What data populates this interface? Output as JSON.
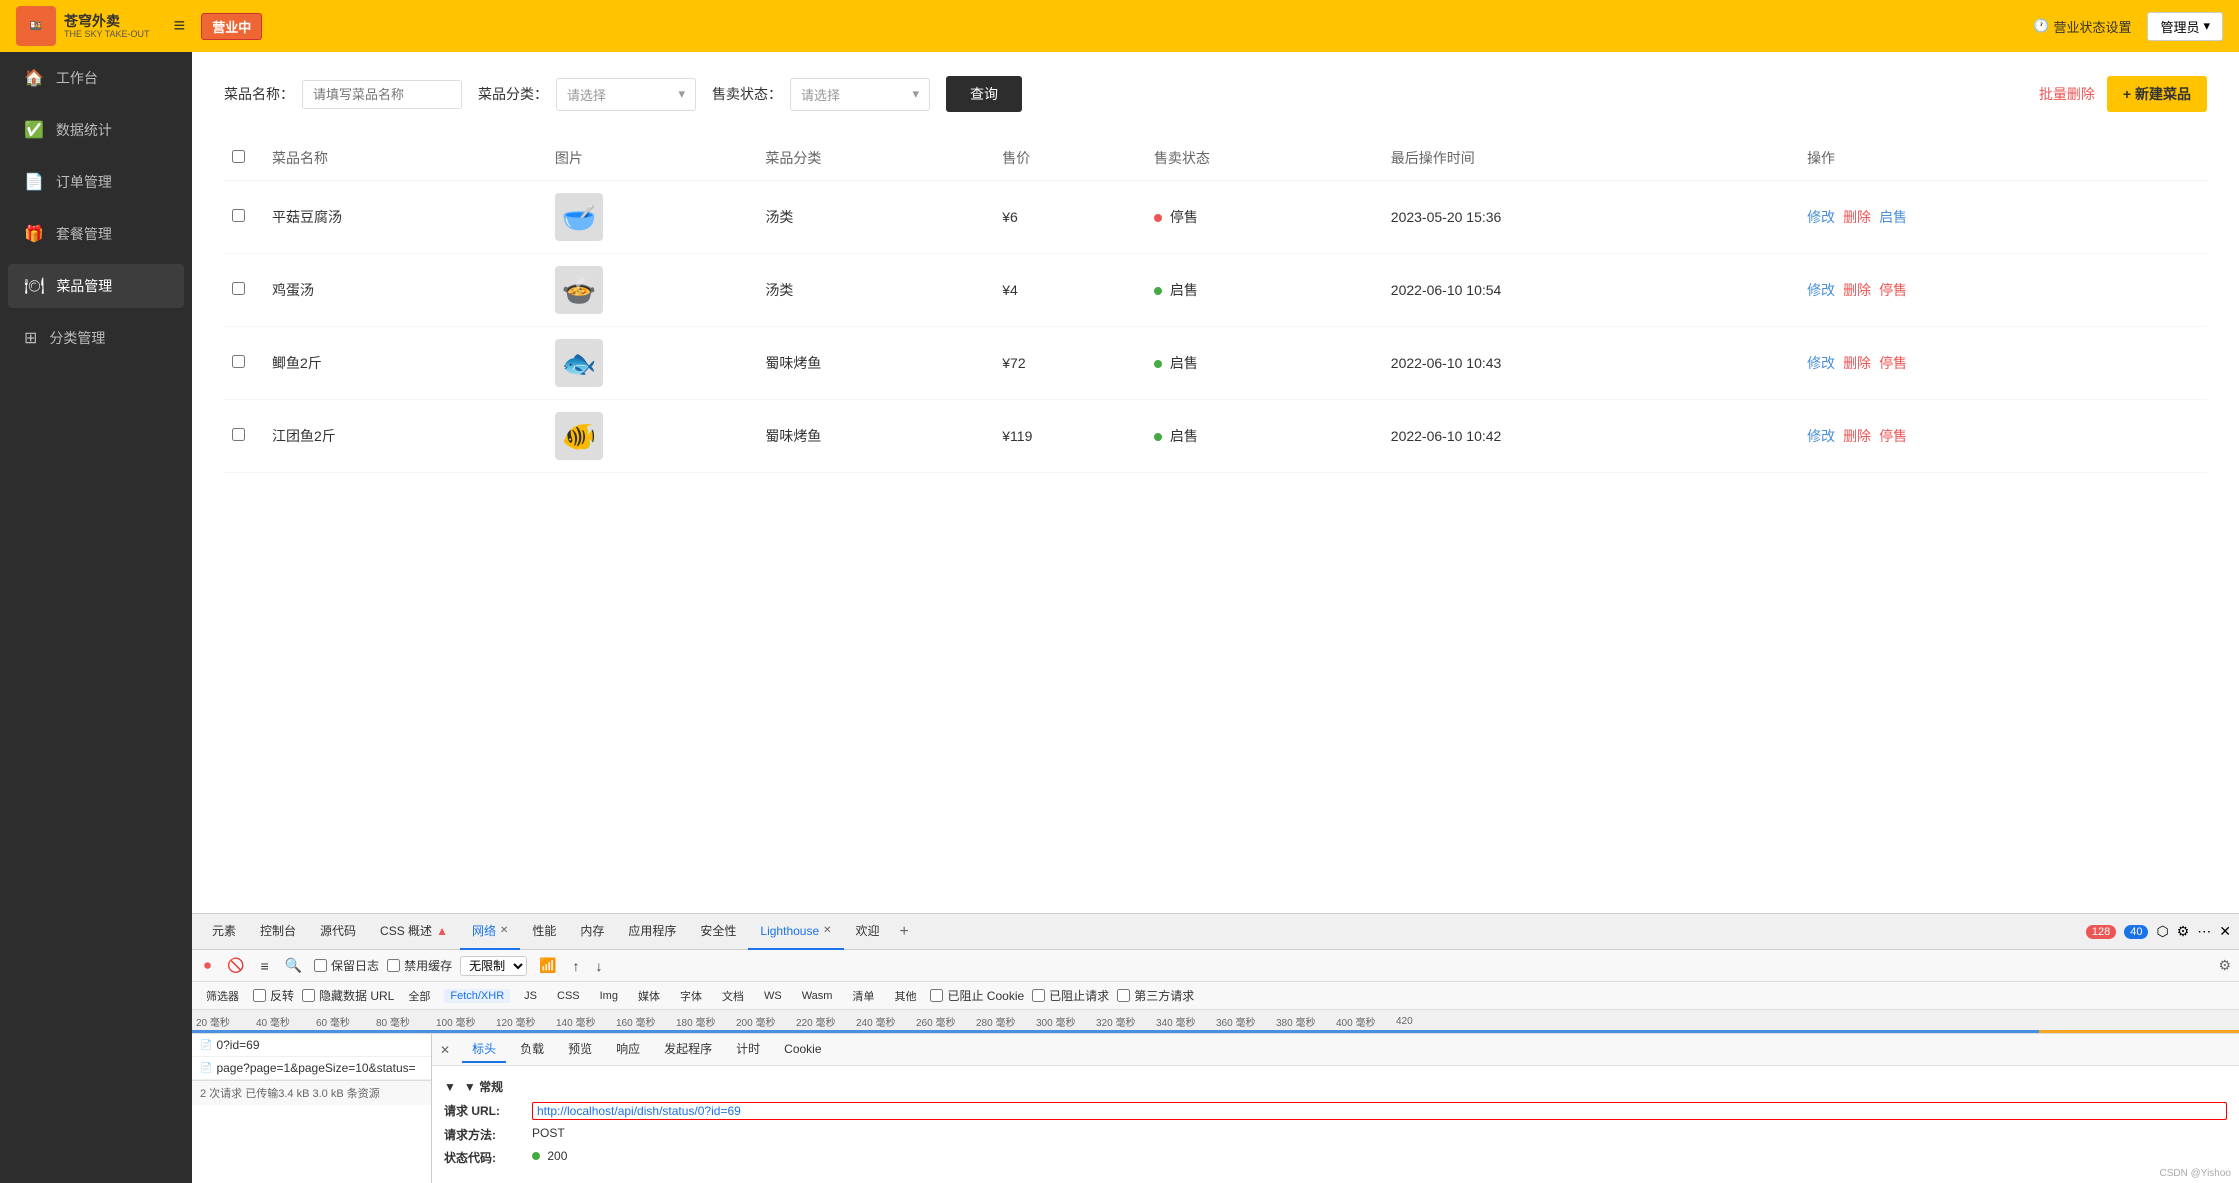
{
  "header": {
    "logo_text": "苍穹外卖",
    "logo_subtext": "THE SKY TAKE-OUT",
    "menu_icon": "≡",
    "status_badge": "营业中",
    "biz_status_label": "营业状态设置",
    "admin_label": "管理员",
    "clock_icon": "🕐"
  },
  "sidebar": {
    "items": [
      {
        "id": "workbench",
        "icon": "🏠",
        "label": "工作台"
      },
      {
        "id": "data-stats",
        "icon": "✅",
        "label": "数据统计"
      },
      {
        "id": "order-mgmt",
        "icon": "📄",
        "label": "订单管理"
      },
      {
        "id": "package-mgmt",
        "icon": "🎁",
        "label": "套餐管理"
      },
      {
        "id": "dish-mgmt",
        "icon": "🍽",
        "label": "菜品管理",
        "active": true
      },
      {
        "id": "category-mgmt",
        "icon": "⊞",
        "label": "分类管理"
      }
    ]
  },
  "filter": {
    "dish_name_label": "菜品名称：",
    "dish_name_placeholder": "请填写菜品名称",
    "category_label": "菜品分类：",
    "category_placeholder": "请选择",
    "status_label": "售卖状态：",
    "status_placeholder": "请选择",
    "query_btn": "查询",
    "batch_delete_btn": "批量删除",
    "new_dish_btn": "+ 新建菜品"
  },
  "table": {
    "headers": [
      "",
      "菜品名称",
      "图片",
      "菜品分类",
      "售价",
      "售卖状态",
      "最后操作时间",
      "操作"
    ],
    "rows": [
      {
        "name": "平菇豆腐汤",
        "img_emoji": "🥣",
        "category": "汤类",
        "price": "¥6",
        "status": "停售",
        "status_type": "red",
        "time": "2023-05-20 15:36",
        "actions": [
          "修改",
          "删除",
          "启售"
        ]
      },
      {
        "name": "鸡蛋汤",
        "img_emoji": "🍲",
        "category": "汤类",
        "price": "¥4",
        "status": "启售",
        "status_type": "green",
        "time": "2022-06-10 10:54",
        "actions": [
          "修改",
          "删除",
          "停售"
        ]
      },
      {
        "name": "鲫鱼2斤",
        "img_emoji": "🐟",
        "category": "蜀味烤鱼",
        "price": "¥72",
        "status": "启售",
        "status_type": "green",
        "time": "2022-06-10 10:43",
        "actions": [
          "修改",
          "删除",
          "停售"
        ]
      },
      {
        "name": "江团鱼2斤",
        "img_emoji": "🐠",
        "category": "蜀味烤鱼",
        "price": "¥119",
        "status": "启售",
        "status_type": "green",
        "time": "2022-06-10 10:42",
        "actions": [
          "修改",
          "删除",
          "停售"
        ]
      }
    ]
  },
  "devtools": {
    "tabs": [
      {
        "label": "元素",
        "active": false
      },
      {
        "label": "控制台",
        "active": false
      },
      {
        "label": "源代码",
        "active": false
      },
      {
        "label": "CSS 概述",
        "active": false,
        "has_dot": true
      },
      {
        "label": "网络",
        "active": true,
        "closable": true
      },
      {
        "label": "性能",
        "active": false
      },
      {
        "label": "内存",
        "active": false
      },
      {
        "label": "应用程序",
        "active": false
      },
      {
        "label": "安全性",
        "active": false
      },
      {
        "label": "Lighthouse",
        "active": true,
        "closable": true
      },
      {
        "label": "欢迎",
        "active": false
      }
    ],
    "badge_red": "128",
    "badge_blue": "40",
    "toolbar": {
      "record_icon": "⏺",
      "stop_icon": "🚫",
      "clear_icon": "≡",
      "search_icon": "🔍",
      "preserve_log": "保留日志",
      "disable_cache": "禁用缓存",
      "throttle": "无限制",
      "wifi_icon": "📶",
      "up_icon": "↑",
      "down_icon": "↓"
    },
    "filter_bar": {
      "selector_label": "筛选器",
      "invert": "反转",
      "hide_data_urls": "隐藏数据 URL",
      "all": "全部",
      "types": [
        "Fetch/XHR",
        "JS",
        "CSS",
        "Img",
        "媒体",
        "字体",
        "文档",
        "WS",
        "Wasm",
        "清单",
        "其他"
      ],
      "blocked_cookie": "已阻止 Cookie",
      "blocked_request": "已阻止请求",
      "third_party": "第三方请求"
    },
    "timeline_labels": [
      "20 毫秒",
      "40 毫秒",
      "60 毫秒",
      "80 毫秒",
      "100 毫秒",
      "120 毫秒",
      "140 毫秒",
      "160 毫秒",
      "180 毫秒",
      "200 毫秒",
      "220 毫秒",
      "240 毫秒",
      "260 毫秒",
      "280 毫秒",
      "300 毫秒",
      "320 毫秒",
      "340 毫秒",
      "360 毫秒",
      "380 毫秒",
      "400 毫秒",
      "420"
    ],
    "list": {
      "items": [
        {
          "icon": "📄",
          "name": "0?id=69"
        },
        {
          "icon": "📄",
          "name": "page?page=1&pageSize=10&status="
        }
      ],
      "footer": "2 次请求  已传输3.4 kB  3.0 kB 条资源"
    },
    "detail": {
      "close_icon": "✕",
      "tabs": [
        "标头",
        "负载",
        "预览",
        "响应",
        "发起程序",
        "计时",
        "Cookie"
      ],
      "active_tab": "标头",
      "section_title": "▼ 常规",
      "rows": [
        {
          "key": "请求 URL:",
          "value": "http://localhost/api/dish/status/0?id=69",
          "highlight": true
        },
        {
          "key": "请求方法:",
          "value": "POST",
          "highlight": false
        },
        {
          "key": "状态代码:",
          "value": "200",
          "status_dot": true,
          "highlight": false
        }
      ]
    }
  }
}
